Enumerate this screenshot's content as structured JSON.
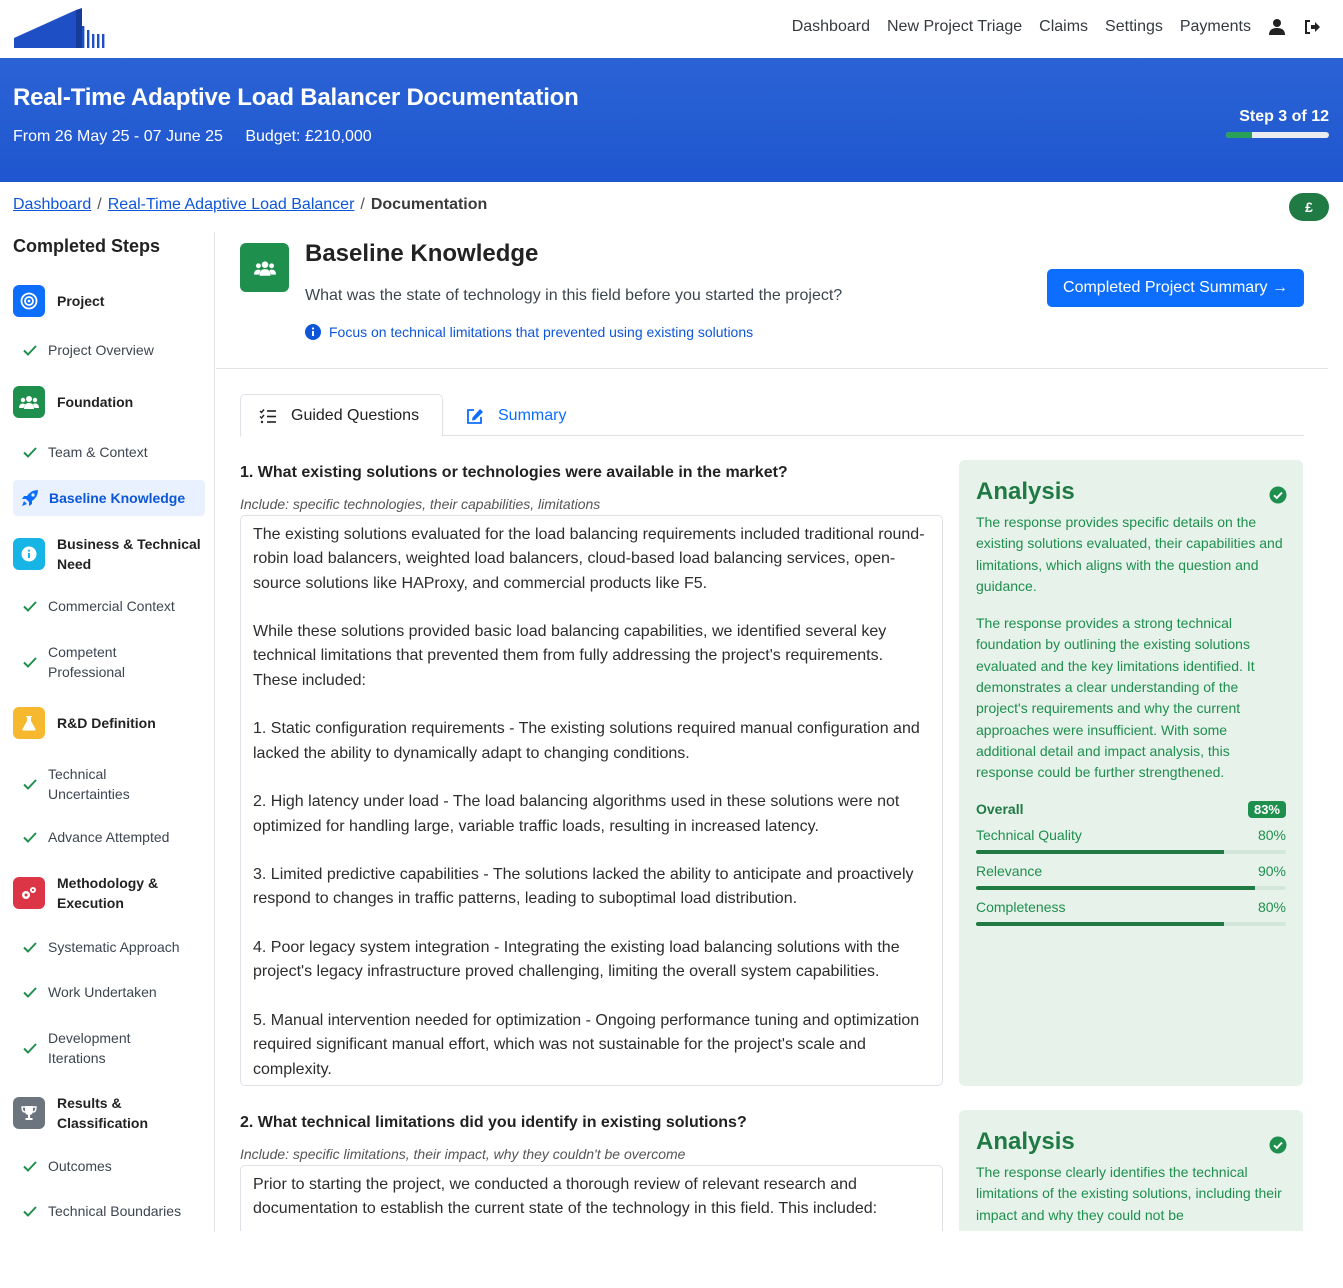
{
  "nav": {
    "links": [
      "Dashboard",
      "New Project Triage",
      "Claims",
      "Settings",
      "Payments"
    ],
    "icons": [
      "user-icon",
      "logout-icon"
    ]
  },
  "banner": {
    "title": "Real-Time Adaptive Load Balancer Documentation",
    "dates": "From 26 May 25 - 07 June 25",
    "budget": "Budget: £210,000",
    "step_label": "Step 3 of 12",
    "step_progress": 0.25
  },
  "breadcrumb": {
    "home": "Dashboard",
    "project": "Real-Time Adaptive Load Balancer",
    "current": "Documentation",
    "separator": "/"
  },
  "currency_button": "£",
  "sidebar": {
    "title": "Completed Steps",
    "phases": [
      {
        "label": "Project",
        "color": "#0d6efd",
        "icon": "target-icon"
      },
      {
        "label": "Foundation",
        "color": "#1f8f4e",
        "icon": "users-icon"
      },
      {
        "label": "Business & Technical Need",
        "color": "#17a2d8",
        "icon": "info-icon"
      },
      {
        "label": "R&D Definition",
        "color": "#f5b82e",
        "icon": "flask-icon"
      },
      {
        "label": "Methodology & Execution",
        "color": "#dc3545",
        "icon": "gears-icon"
      },
      {
        "label": "Results & Classification",
        "color": "#6c757d",
        "icon": "trophy-icon"
      }
    ],
    "steps": [
      "Project Overview",
      "Team & Context",
      "Baseline Knowledge",
      "Commercial Context",
      "Competent Professional",
      "Technical Uncertainties",
      "Advance Attempted",
      "Systematic Approach",
      "Work Undertaken",
      "Development Iterations",
      "Outcomes",
      "Technical Boundaries"
    ]
  },
  "section": {
    "title": "Baseline Knowledge",
    "question": "What was the state of technology in this field before you started the project?",
    "hint": "Focus on technical limitations that prevented using existing solutions",
    "summary_button": "Completed Project Summary →"
  },
  "tabs": {
    "guided": "Guided Questions",
    "summary": "Summary"
  },
  "questions": [
    {
      "title": "1. What existing solutions or technologies were available in the market?",
      "hint": "Include: specific technologies, their capabilities, limitations",
      "answer": [
        "The existing solutions evaluated for the load balancing requirements included traditional round-robin load balancers, weighted load balancers, cloud-based load balancing services, open-source solutions like HAProxy, and commercial products like F5.",
        "While these solutions provided basic load balancing capabilities, we identified several key technical limitations that prevented them from fully addressing the project's requirements. These included:",
        "1. Static configuration requirements - The existing solutions required manual configuration and lacked the ability to dynamically adapt to changing conditions.",
        "2. High latency under load - The load balancing algorithms used in these solutions were not optimized for handling large, variable traffic loads, resulting in increased latency.",
        "3. Limited predictive capabilities - The solutions lacked the ability to anticipate and proactively respond to changes in traffic patterns, leading to suboptimal load distribution.",
        "4. Poor legacy system integration - Integrating the existing load balancing solutions with the project's legacy infrastructure proved challenging, limiting the overall system capabilities.",
        "5. Manual intervention needed for optimization - Ongoing performance tuning and optimization required significant manual effort, which was not sustainable for the project's scale and complexity."
      ],
      "analysis": {
        "title": "Analysis",
        "text": [
          "The response provides specific details on the existing solutions evaluated, their capabilities and limitations, which aligns with the question and guidance.",
          "The response provides a strong technical foundation by outlining the existing solutions evaluated and the key limitations identified. It demonstrates a clear understanding of the project's requirements and why the current approaches were insufficient. With some additional detail and impact analysis, this response could be further strengthened."
        ],
        "overall_label": "Overall",
        "overall_value": "83%",
        "metrics": [
          {
            "label": "Technical Quality",
            "value": "80%",
            "fraction": 0.8
          },
          {
            "label": "Relevance",
            "value": "90%",
            "fraction": 0.9
          },
          {
            "label": "Completeness",
            "value": "80%",
            "fraction": 0.8
          }
        ]
      }
    },
    {
      "title": "2. What technical limitations did you identify in existing solutions?",
      "hint": "Include: specific limitations, their impact, why they couldn't be overcome",
      "answer": [
        "Prior to starting the project, we conducted a thorough review of relevant research and documentation to establish the current state of the technology in this field. This included:"
      ],
      "analysis": {
        "title": "Analysis",
        "text": [
          "The response clearly identifies the technical limitations of the existing solutions, including their impact and why they could not be"
        ]
      }
    }
  ]
}
